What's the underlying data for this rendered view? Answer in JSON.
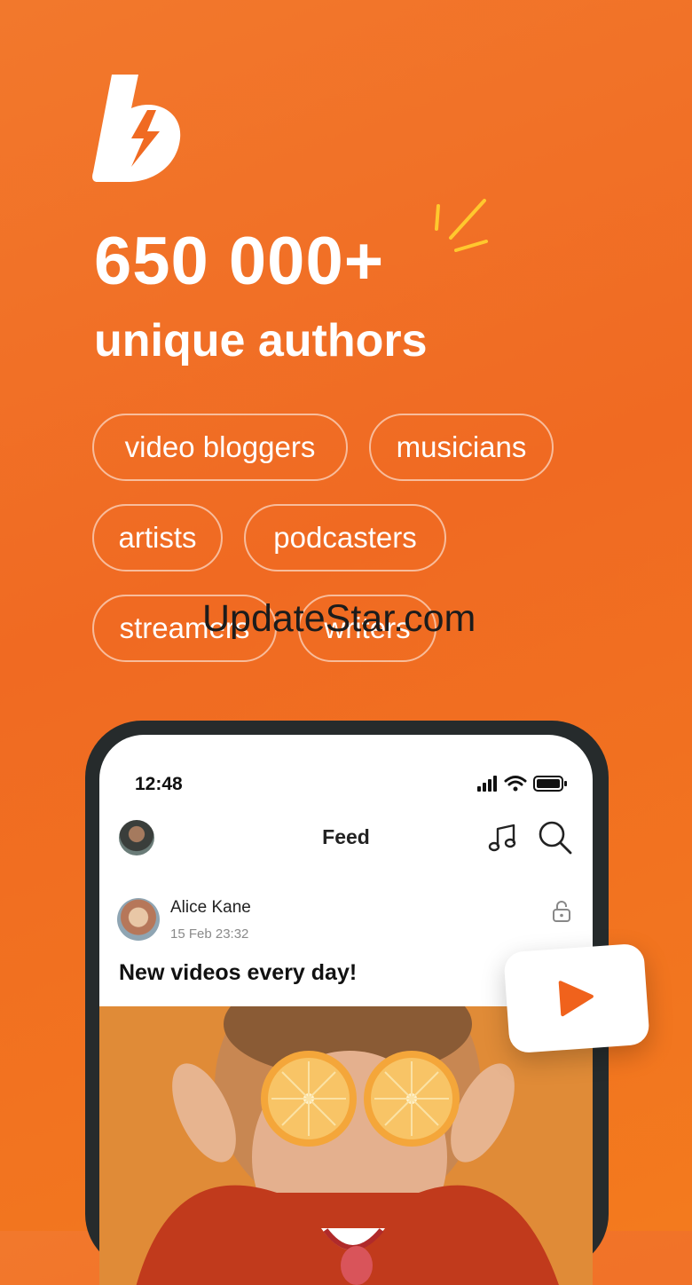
{
  "headline": {
    "count": "650 000+",
    "subtitle": "unique authors"
  },
  "categories": [
    "video bloggers",
    "musicians",
    "artists",
    "podcasters",
    "streamers",
    "writers"
  ],
  "watermark": "UpdateStar.com",
  "phone": {
    "status_time": "12:48",
    "nav_title": "Feed",
    "post": {
      "author": "Alice Kane",
      "date": "15 Feb 23:32",
      "title": "New videos every day!"
    }
  },
  "colors": {
    "brand_orange": "#f06a22",
    "accent_yellow": "#ffc82e",
    "phone_frame": "#262b2c"
  },
  "icons": [
    "logo-icon",
    "sparkle-icon",
    "signal-icon",
    "wifi-icon",
    "battery-icon",
    "music-note-icon",
    "search-icon",
    "lock-icon",
    "play-icon"
  ]
}
